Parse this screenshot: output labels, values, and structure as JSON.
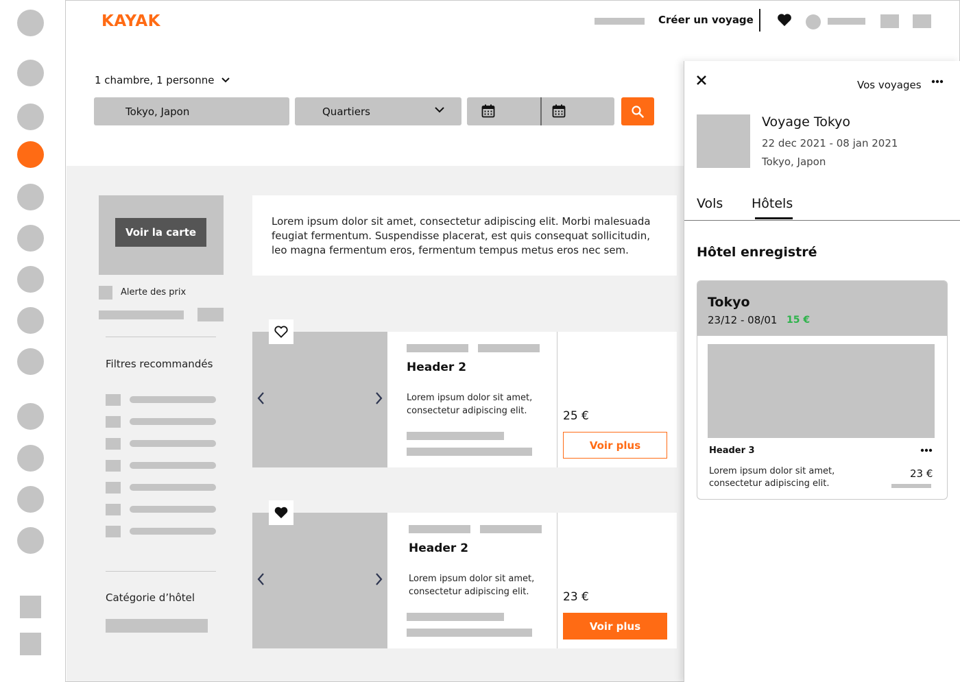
{
  "brand": {
    "logo": "KAYAK",
    "accent": "#ff6b14"
  },
  "header": {
    "create_trip": "Créer un voyage"
  },
  "search": {
    "rooms": "1 chambre, 1 personne",
    "destination": "Tokyo, Japon",
    "quarters": "Quartiers"
  },
  "filters": {
    "map_button": "Voir la carte",
    "price_alert": "Alerte des prix",
    "recommended": "Filtres recommandés",
    "hotel_category": "Catégorie d’hôtel"
  },
  "intro_text": "Lorem ipsum dolor sit amet, consectetur adipiscing elit. Morbi malesuada feugiat fermentum. Suspendisse placerat, est quis consequat sollicitudin, leo magna fermentum eros, fermentum tempus metus eros nec sem.",
  "results": [
    {
      "title": "Header 2",
      "description": "Lorem ipsum dolor sit amet, consectetur adipiscing elit.",
      "price": "25 €",
      "cta": "Voir plus",
      "favorited": false
    },
    {
      "title": "Header 2",
      "description": "Lorem ipsum dolor sit amet, consectetur adipiscing elit.",
      "price": "23 €",
      "cta": "Voir plus",
      "favorited": true
    }
  ],
  "panel": {
    "your_trips": "Vos voyages",
    "trip_title": "Voyage Tokyo",
    "trip_dates": "22 dec 2021 - 08 jan 2021",
    "trip_place": "Tokyo, Japon",
    "tabs": [
      "Vols",
      "Hôtels"
    ],
    "active_tab": "Hôtels",
    "saved_title": "Hôtel enregistré",
    "saved": {
      "city": "Tokyo",
      "range": "23/12 - 08/01",
      "price_drop": "15 €",
      "price_drop_color": "#2db34a",
      "header": "Header 3",
      "description": "Lorem ipsum dolor sit amet, consectetur adipiscing elit.",
      "price": "23 €"
    }
  }
}
